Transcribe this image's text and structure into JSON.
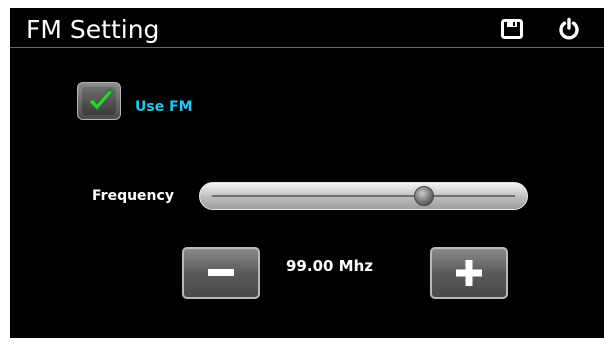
{
  "header": {
    "title": "FM Setting",
    "save_icon": "save-icon",
    "power_icon": "power-icon"
  },
  "use_fm": {
    "label": "Use FM",
    "checked": true,
    "check_icon": "checkmark-icon"
  },
  "frequency": {
    "label": "Frequency",
    "value_text": "99.00 Mhz",
    "slider_level": 0.7,
    "minus_icon": "minus-icon",
    "plus_icon": "plus-icon"
  },
  "colors": {
    "accent_label": "#1ec8f0",
    "check_green": "#3cc83c",
    "background": "#000000"
  }
}
